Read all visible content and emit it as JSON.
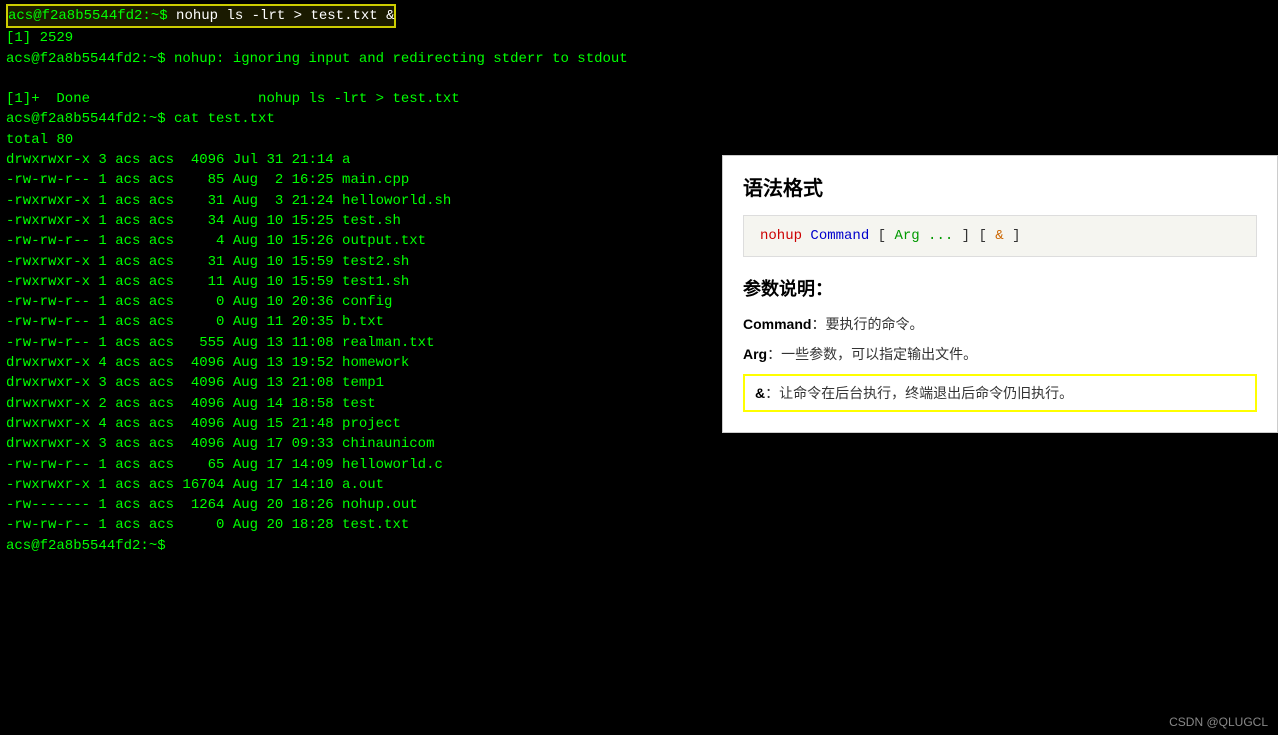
{
  "terminal": {
    "lines": [
      {
        "type": "command-highlighted",
        "text": "acs@f2a8b5544fd2:~$ nohup ls -lrt > test.txt &"
      },
      {
        "type": "output",
        "text": "[1] 2529"
      },
      {
        "type": "output",
        "text": "acs@f2a8b5544fd2:~$ nohup: ignoring input and redirecting stderr to stdout"
      },
      {
        "type": "blank"
      },
      {
        "type": "output",
        "text": "[1]+  Done                    nohup ls -lrt > test.txt"
      },
      {
        "type": "output",
        "text": "acs@f2a8b5544fd2:~$ cat test.txt"
      },
      {
        "type": "output",
        "text": "total 80"
      },
      {
        "type": "output",
        "text": "drwxrwxr-x 3 acs acs  4096 Jul 31 21:14 a"
      },
      {
        "type": "output",
        "text": "-rw-rw-r-- 1 acs acs    85 Aug  2 16:25 main.cpp"
      },
      {
        "type": "output",
        "text": "-rwxrwxr-x 1 acs acs    31 Aug  3 21:24 helloworld.sh"
      },
      {
        "type": "output",
        "text": "-rwxrwxr-x 1 acs acs    34 Aug 10 15:25 test.sh"
      },
      {
        "type": "output",
        "text": "-rw-rw-r-- 1 acs acs     4 Aug 10 15:26 output.txt"
      },
      {
        "type": "output",
        "text": "-rwxrwxr-x 1 acs acs    31 Aug 10 15:59 test2.sh"
      },
      {
        "type": "output",
        "text": "-rwxrwxr-x 1 acs acs    11 Aug 10 15:59 test1.sh"
      },
      {
        "type": "output",
        "text": "-rw-rw-r-- 1 acs acs     0 Aug 10 20:36 config"
      },
      {
        "type": "output",
        "text": "-rw-rw-r-- 1 acs acs     0 Aug 11 20:35 b.txt"
      },
      {
        "type": "output",
        "text": "-rw-rw-r-- 1 acs acs   555 Aug 13 11:08 realman.txt"
      },
      {
        "type": "output",
        "text": "drwxrwxr-x 4 acs acs  4096 Aug 13 19:52 homework"
      },
      {
        "type": "output",
        "text": "drwxrwxr-x 3 acs acs  4096 Aug 13 21:08 temp1"
      },
      {
        "type": "output",
        "text": "drwxrwxr-x 2 acs acs  4096 Aug 14 18:58 test"
      },
      {
        "type": "output",
        "text": "drwxrwxr-x 4 acs acs  4096 Aug 15 21:48 project"
      },
      {
        "type": "output",
        "text": "drwxrwxr-x 3 acs acs  4096 Aug 17 09:33 chinaunicom"
      },
      {
        "type": "output",
        "text": "-rw-rw-r-- 1 acs acs    65 Aug 17 14:09 helloworld.c"
      },
      {
        "type": "output",
        "text": "-rwxrwxr-x 1 acs acs 16704 Aug 17 14:10 a.out"
      },
      {
        "type": "output",
        "text": "-rw------- 1 acs acs  1264 Aug 20 18:26 nohup.out"
      },
      {
        "type": "output",
        "text": "-rw-rw-r-- 1 acs acs     0 Aug 20 18:28 test.txt"
      },
      {
        "type": "prompt",
        "text": "acs@f2a8b5544fd2:~$ "
      }
    ]
  },
  "sidebar": {
    "syntax_title": "语法格式",
    "syntax_code": "nohup  Command  [  Arg ...  ]  [  &  ]",
    "syntax_nohup": "nohup",
    "syntax_command": "Command",
    "syntax_arg": "Arg ...",
    "syntax_amp": "&",
    "params_title": "参数说明：",
    "params": [
      {
        "key": "Command",
        "separator": "：",
        "desc": "要执行的命令。"
      },
      {
        "key": "Arg",
        "separator": "：",
        "desc": "一些参数，可以指定输出文件。"
      },
      {
        "key": "&",
        "separator": "：",
        "desc": "让命令在后台执行，终端退出后命令仍旧执行。",
        "highlighted": true
      }
    ]
  },
  "watermark": {
    "text": "CSDN @QLUGCL"
  }
}
